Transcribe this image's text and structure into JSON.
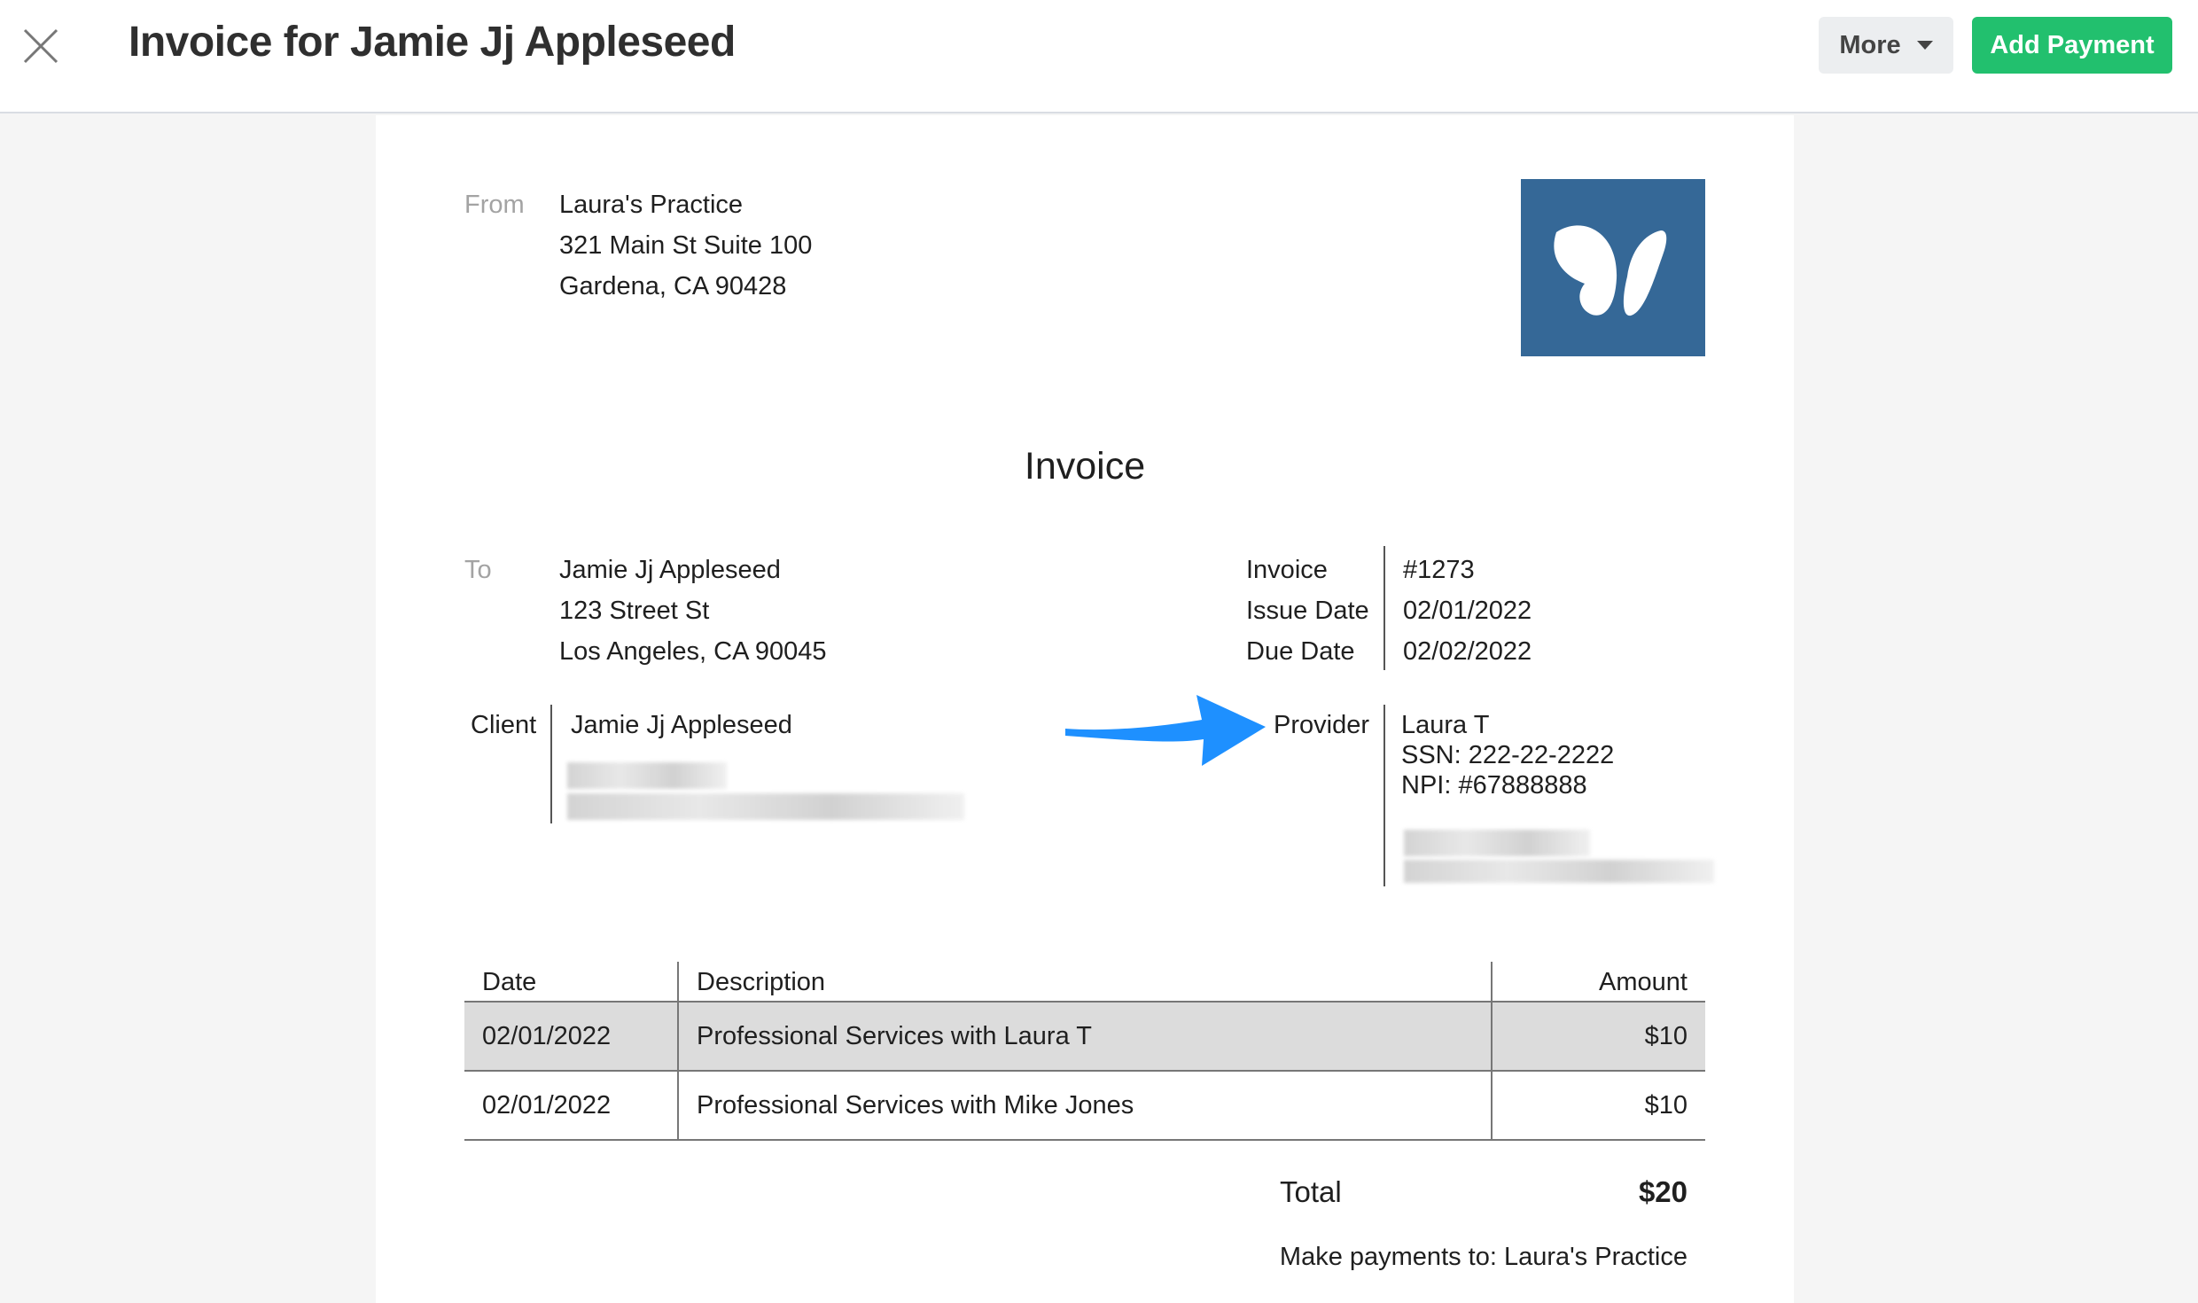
{
  "header": {
    "title": "Invoice for Jamie Jj Appleseed",
    "more_label": "More",
    "add_payment_label": "Add Payment"
  },
  "from": {
    "label": "From",
    "lines": [
      "Laura's Practice",
      "321 Main St Suite 100",
      "Gardena, CA 90428"
    ]
  },
  "invoice_title": "Invoice",
  "to": {
    "label": "To",
    "lines": [
      "Jamie Jj Appleseed",
      "123 Street St",
      "Los Angeles, CA 90045"
    ]
  },
  "meta": {
    "invoice_label": "Invoice",
    "invoice_value": "#1273",
    "issue_label": "Issue Date",
    "issue_value": "02/01/2022",
    "due_label": "Due Date",
    "due_value": "02/02/2022"
  },
  "client": {
    "label": "Client",
    "name": "Jamie Jj Appleseed"
  },
  "provider": {
    "label": "Provider",
    "name": "Laura T",
    "ssn": "SSN: 222-22-2222",
    "npi": "NPI: #67888888"
  },
  "table": {
    "headers": [
      "Date",
      "Description",
      "Amount"
    ],
    "rows": [
      {
        "date": "02/01/2022",
        "description": "Professional Services with Laura T",
        "amount": "$10"
      },
      {
        "date": "02/01/2022",
        "description": "Professional Services with Mike Jones",
        "amount": "$10"
      }
    ]
  },
  "total": {
    "label": "Total",
    "value": "$20"
  },
  "payment_note": "Make payments to: Laura's Practice",
  "colors": {
    "accent_green": "#22c06e",
    "logo_blue": "#356897",
    "arrow_blue": "#1e90ff"
  }
}
